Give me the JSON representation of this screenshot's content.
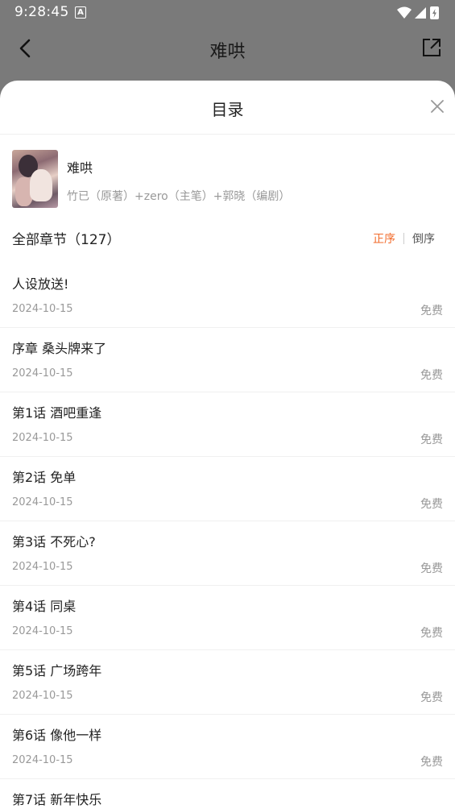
{
  "status_bar": {
    "time": "9:28:45",
    "notification_badge": "A",
    "icons": [
      "wifi-icon",
      "signal-icon",
      "battery-charging-icon"
    ]
  },
  "top_bar": {
    "title": "难哄",
    "back_icon": "chevron-left-icon",
    "share_icon": "share-out-icon"
  },
  "sheet": {
    "title": "目录",
    "close_icon": "close-icon",
    "book": {
      "name": "难哄",
      "authors": "竹已（原著）+zero（主笔）+郭晓（编剧）"
    },
    "chapter_header": {
      "total_label": "全部章节（127）",
      "order_asc": "正序",
      "order_desc": "倒序"
    },
    "chapters": [
      {
        "title": "人设放送!",
        "date": "2024-10-15",
        "price": "免费"
      },
      {
        "title": "序章 桑头牌来了",
        "date": "2024-10-15",
        "price": "免费"
      },
      {
        "title": "第1话 酒吧重逢",
        "date": "2024-10-15",
        "price": "免费"
      },
      {
        "title": "第2话 免单",
        "date": "2024-10-15",
        "price": "免费"
      },
      {
        "title": "第3话 不死心?",
        "date": "2024-10-15",
        "price": "免费"
      },
      {
        "title": "第4话 同桌",
        "date": "2024-10-15",
        "price": "免费"
      },
      {
        "title": "第5话 广场跨年",
        "date": "2024-10-15",
        "price": "免费"
      },
      {
        "title": "第6话 像他一样",
        "date": "2024-10-15",
        "price": "免费"
      },
      {
        "title": "第7话 新年快乐",
        "date": "",
        "price": ""
      }
    ]
  },
  "colors": {
    "accent": "#f26b2b",
    "overlay": "#7a7a7a"
  }
}
